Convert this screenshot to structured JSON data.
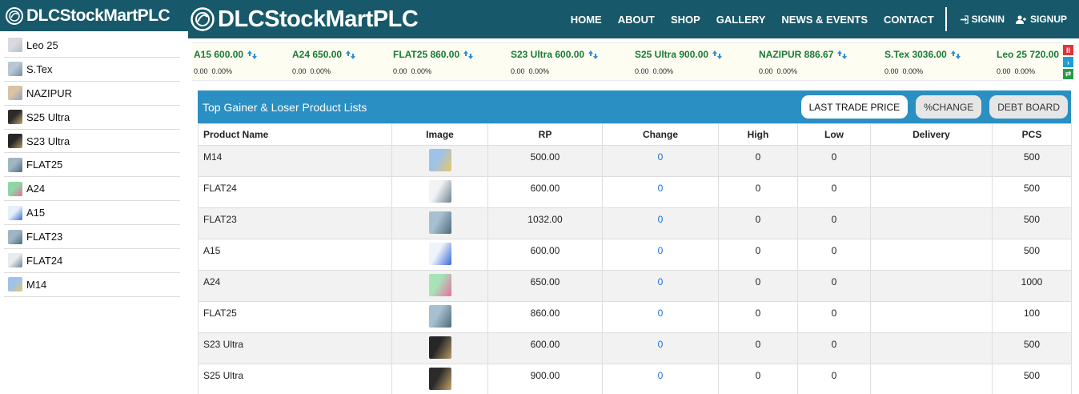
{
  "sidebar": {
    "brand": "DLCStockMartPLC",
    "items": [
      {
        "label": "Leo 25",
        "thumb": "#d8dadf",
        "thumb2": "#b9bcc3"
      },
      {
        "label": "S.Tex",
        "thumb": "#b8c7d6",
        "thumb2": "#7a8a9a"
      },
      {
        "label": "NAZIPUR",
        "thumb": "#d9c3a4",
        "thumb2": "#8ba3c5"
      },
      {
        "label": "S25 Ultra",
        "thumb": "#2b2b2b",
        "thumb2": "#c8a66a"
      },
      {
        "label": "S23 Ultra",
        "thumb": "#262626",
        "thumb2": "#b59a6b"
      },
      {
        "label": "FLAT25",
        "thumb": "#9fb5c4",
        "thumb2": "#4d6b7e"
      },
      {
        "label": "A24",
        "thumb": "#8fd6a4",
        "thumb2": "#e76fa5"
      },
      {
        "label": "A15",
        "thumb": "#e6f0fb",
        "thumb2": "#3b6ad6"
      },
      {
        "label": "FLAT23",
        "thumb": "#9fb5c4",
        "thumb2": "#4d6b7e"
      },
      {
        "label": "FLAT24",
        "thumb": "#e8ecef",
        "thumb2": "#6f8290"
      },
      {
        "label": "M14",
        "thumb": "#9ec2e9",
        "thumb2": "#e7c66a"
      }
    ]
  },
  "header": {
    "brand": "DLCStockMartPLC",
    "nav": [
      "HOME",
      "ABOUT",
      "SHOP",
      "GALLERY",
      "NEWS & EVENTS",
      "CONTACT"
    ],
    "signin": "SIGNIN",
    "signup": "SIGNUP"
  },
  "ticker": {
    "items": [
      {
        "name": "A15 600.00",
        "change": "0.00",
        "pct": "0.00%"
      },
      {
        "name": "A24 650.00",
        "change": "0.00",
        "pct": "0.00%"
      },
      {
        "name": "FLAT25 860.00",
        "change": "0.00",
        "pct": "0.00%"
      },
      {
        "name": "S23 Ultra 600.00",
        "change": "0.00",
        "pct": "0.00%"
      },
      {
        "name": "S25 Ultra 900.00",
        "change": "0.00",
        "pct": "0.00%"
      },
      {
        "name": "NAZIPUR 886.67",
        "change": "0.00",
        "pct": "0.00%"
      },
      {
        "name": "S.Tex 3036.00",
        "change": "0.00",
        "pct": "0.00%"
      },
      {
        "name": "Leo 25 720.00",
        "change": "0.00",
        "pct": "0.00%"
      }
    ],
    "controls": [
      {
        "icon": "pause-icon",
        "glyph": "II",
        "color": "#e0323a"
      },
      {
        "icon": "next-icon",
        "glyph": "›",
        "color": "#1e9ed8"
      },
      {
        "icon": "toggle-icon",
        "glyph": "⇄",
        "color": "#2a9a4a"
      }
    ]
  },
  "panel": {
    "title": "Top Gainer & Loser Product Lists",
    "buttons": [
      "LAST TRADE PRICE",
      "%CHANGE",
      "DEBT BOARD"
    ],
    "columns": [
      "Product Name",
      "Image",
      "RP",
      "Change",
      "High",
      "Low",
      "Delivery",
      "PCS"
    ],
    "rows": [
      {
        "name": "M14",
        "rp": "500.00",
        "change": "0",
        "high": "0",
        "low": "0",
        "delivery": "",
        "pcs": "500",
        "c1": "#9ec2e9",
        "c2": "#e7c66a"
      },
      {
        "name": "FLAT24",
        "rp": "600.00",
        "change": "0",
        "high": "0",
        "low": "0",
        "delivery": "",
        "pcs": "500",
        "c1": "#f1f3f4",
        "c2": "#6f8290"
      },
      {
        "name": "FLAT23",
        "rp": "1032.00",
        "change": "0",
        "high": "0",
        "low": "0",
        "delivery": "",
        "pcs": "500",
        "c1": "#a7bfcf",
        "c2": "#4d6b7e"
      },
      {
        "name": "A15",
        "rp": "600.00",
        "change": "0",
        "high": "0",
        "low": "0",
        "delivery": "",
        "pcs": "500",
        "c1": "#eef4fb",
        "c2": "#3b6ad6"
      },
      {
        "name": "A24",
        "rp": "650.00",
        "change": "0",
        "high": "0",
        "low": "0",
        "delivery": "",
        "pcs": "1000",
        "c1": "#a8e3b7",
        "c2": "#e76fa5"
      },
      {
        "name": "FLAT25",
        "rp": "860.00",
        "change": "0",
        "high": "0",
        "low": "0",
        "delivery": "",
        "pcs": "100",
        "c1": "#a7bfcf",
        "c2": "#4d6b7e"
      },
      {
        "name": "S23 Ultra",
        "rp": "600.00",
        "change": "0",
        "high": "0",
        "low": "0",
        "delivery": "",
        "pcs": "500",
        "c1": "#262626",
        "c2": "#b59a6b"
      },
      {
        "name": "S25 Ultra",
        "rp": "900.00",
        "change": "0",
        "high": "0",
        "low": "0",
        "delivery": "",
        "pcs": "500",
        "c1": "#2b2b2b",
        "c2": "#c8a66a"
      }
    ]
  },
  "colors": {
    "brand": "#17596a",
    "panel_head": "#2a8fc2",
    "ticker_up": "#1a7a34",
    "change_link": "#1f6fd1"
  }
}
